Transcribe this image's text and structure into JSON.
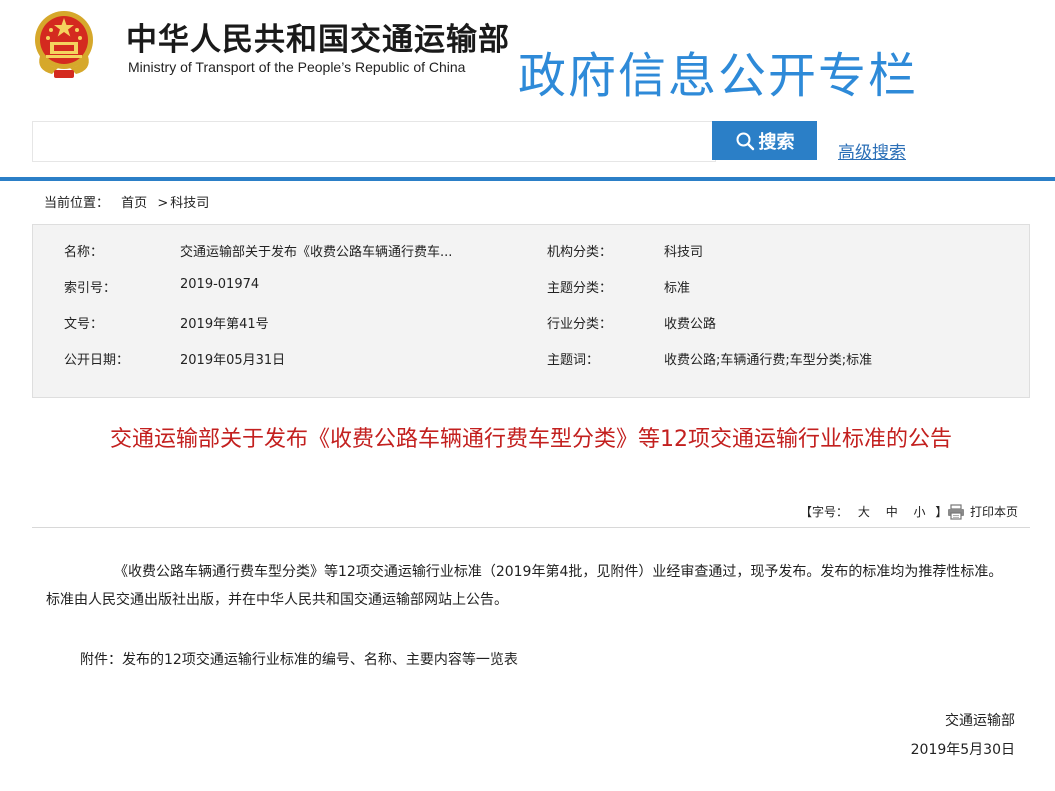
{
  "header": {
    "site_name_cn": "中华人民共和国交通运输部",
    "site_name_en": "Ministry of Transport of the People’s Republic of China",
    "column_title": "政府信息公开专栏",
    "emblem_icon": "national-emblem-icon"
  },
  "search": {
    "value": "",
    "button_label": "搜索",
    "advanced_link": "高级搜索",
    "icon": "search-icon"
  },
  "breadcrumb": {
    "prefix": "当前位置：",
    "home": "首页",
    "separator": ">",
    "current": "科技司"
  },
  "meta": {
    "left": [
      {
        "label": "名称：",
        "value": "交通运输部关于发布《收费公路车辆通行费车..."
      },
      {
        "label": "索引号：",
        "value": "2019-01974"
      },
      {
        "label": "文号：",
        "value": "2019年第41号"
      },
      {
        "label": "公开日期：",
        "value": "2019年05月31日"
      }
    ],
    "right": [
      {
        "label": "机构分类：",
        "value": "科技司"
      },
      {
        "label": "主题分类：",
        "value": "标准"
      },
      {
        "label": "行业分类：",
        "value": "收费公路"
      },
      {
        "label": "主题词：",
        "value": "收费公路;车辆通行费;车型分类;标准"
      }
    ]
  },
  "article": {
    "title": "交通运输部关于发布《收费公路车辆通行费车型分类》等12项交通运输行业标准的公告",
    "tools": {
      "font_prefix": "【字号：",
      "large": "大",
      "medium": "中",
      "small": "小",
      "font_suffix": "】",
      "print_label": "打印本页",
      "print_icon": "printer-icon"
    },
    "body": "《收费公路车辆通行费车型分类》等12项交通运输行业标准（2019年第4批，见附件）业经审查通过，现予发布。发布的标准均为推荐性标准。标准由人民交通出版社出版，并在中华人民共和国交通运输部网站上公告。",
    "attachment": "附件：发布的12项交通运输行业标准的编号、名称、主要内容等一览表",
    "sign_org": "交通运输部",
    "sign_date": "2019年5月30日"
  },
  "colors": {
    "accent_blue": "#2b7fc7",
    "title_red": "#c3201f",
    "column_title_blue": "#2e8ad8"
  }
}
